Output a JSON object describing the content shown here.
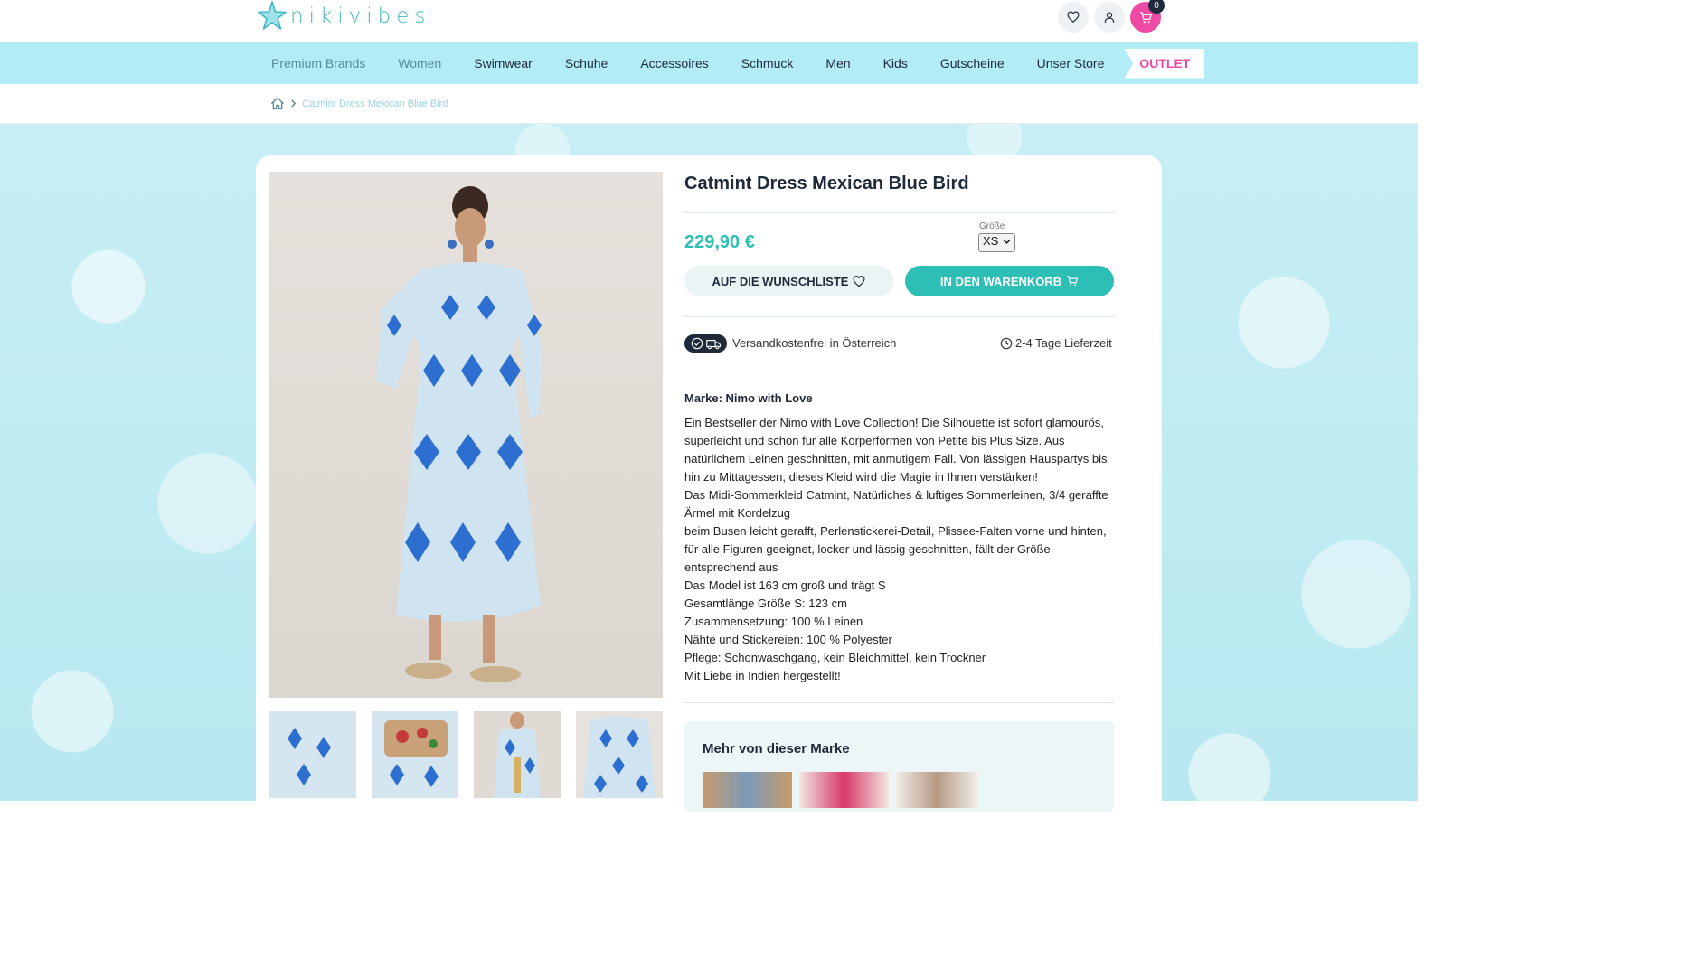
{
  "header": {
    "logo_text": "nikivibes",
    "cart_count": "0",
    "icons": [
      "heart-icon",
      "user-icon",
      "cart-icon"
    ]
  },
  "nav": {
    "items": [
      {
        "label": "Premium Brands"
      },
      {
        "label": "Women"
      },
      {
        "label": "Swimwear"
      },
      {
        "label": "Schuhe"
      },
      {
        "label": "Accessoires"
      },
      {
        "label": "Schmuck"
      },
      {
        "label": "Men"
      },
      {
        "label": "Kids"
      },
      {
        "label": "Gutscheine"
      },
      {
        "label": "Unser Store"
      }
    ],
    "outlet": "OUTLET"
  },
  "breadcrumb": {
    "current": "Catmint Dress Mexican Blue Bird"
  },
  "product": {
    "title": "Catmint Dress Mexican Blue Bird",
    "price": "229,90 €",
    "size_label": "Größe",
    "size_value": "XS",
    "wishlist_button": "AUF DIE WUNSCHLISTE",
    "cart_button": "IN DEN WARENKORB",
    "shipping": "Versandkostenfrei in Österreich",
    "delivery": "2-4 Tage Lieferzeit",
    "brand": "Marke: Nimo with Love",
    "description": [
      "Ein Bestseller der Nimo with Love Collection! Die Silhouette ist sofort glamourös, superleicht und schön für alle Körperformen von Petite bis Plus Size. Aus natürlichem Leinen geschnitten, mit anmutigem Fall. Von lässigen Hauspartys bis hin zu Mittagessen, dieses Kleid wird die Magie in Ihnen verstärken!",
      "Das Midi-Sommerkleid Catmint, Natürliches & luftiges Sommerleinen, 3/4 geraffte Ärmel mit Kordelzug",
      "beim Busen leicht gerafft, Perlenstickerei-Detail, Plissee-Falten vorne und hinten, für alle Figuren geeignet, locker und lässig geschnitten, fällt der Größe entsprechend aus",
      "Das Model ist 163 cm groß und trägt S",
      "Gesamtlänge Größe S: 123 cm",
      "Zusammensetzung: 100 % Leinen",
      "Nähte und Stickereien: 100 % Polyester",
      "Pflege: Schonwaschgang, kein Bleichmittel, kein Trockner",
      "Mit Liebe in Indien hergestellt!"
    ]
  },
  "more_from_brand": {
    "title": "Mehr von dieser Marke"
  },
  "colors": {
    "accent": "#2dbfb5",
    "pink": "#ec4aa5",
    "nav_bg": "#b2ecf6",
    "dark": "#1e2a3a"
  }
}
